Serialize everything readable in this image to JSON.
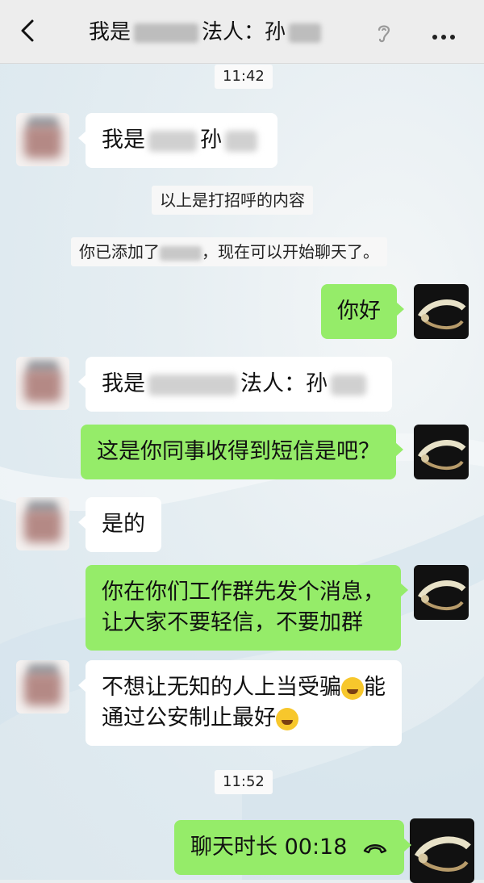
{
  "header": {
    "title_prefix": "我是",
    "title_mid": "法人：孙",
    "back_icon": "chevron-left-icon",
    "ear_icon": "earpiece-icon",
    "more_icon": "more-dots-icon"
  },
  "timestamps": [
    "11:42",
    "11:52"
  ],
  "system_messages": {
    "greeting_note": "以上是打招呼的内容",
    "added_prefix": "你已添加了",
    "added_suffix": "，现在可以开始聊天了。"
  },
  "messages": [
    {
      "side": "left",
      "text_a": "我是",
      "text_b": "孙"
    },
    {
      "side": "right",
      "text": "你好"
    },
    {
      "side": "left",
      "text_a": "我是",
      "text_b": "法人：孙"
    },
    {
      "side": "right",
      "text": "这是你同事收得到短信是吧？"
    },
    {
      "side": "left",
      "text": "是的"
    },
    {
      "side": "right",
      "line1": "你在你们工作群先发个消息，",
      "line2": "让大家不要轻信，不要加群"
    },
    {
      "side": "left",
      "line1": "不想让无知的人上当受骗",
      "line1_end": "能",
      "line2": "通过公安制止最好",
      "emoji1": "crying-laughing-emoji",
      "emoji2": "grinning-emoji"
    },
    {
      "side": "right",
      "text": "聊天时长 00:18",
      "icon": "hang-up-icon"
    }
  ]
}
